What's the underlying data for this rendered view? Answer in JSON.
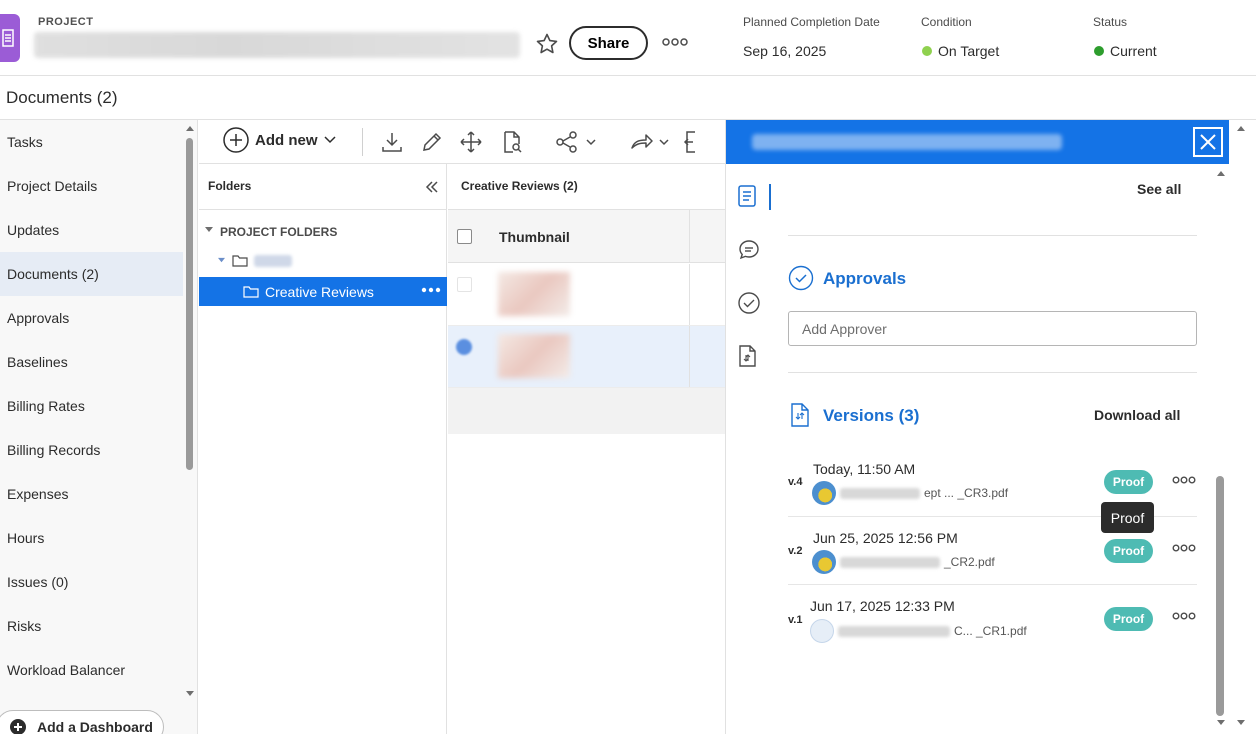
{
  "header": {
    "project_label": "PROJECT",
    "share_label": "Share",
    "meta": [
      {
        "label": "Planned Completion Date",
        "value": "Sep 16, 2025"
      },
      {
        "label": "Condition",
        "value": "On Target",
        "dot_color": "#8fd14f"
      },
      {
        "label": "Status",
        "value": "Current",
        "dot_color": "#2d9d2d"
      }
    ]
  },
  "page_title": "Documents (2)",
  "sidebar": {
    "items": [
      {
        "label": "Tasks"
      },
      {
        "label": "Project Details"
      },
      {
        "label": "Updates"
      },
      {
        "label": "Documents (2)"
      },
      {
        "label": "Approvals"
      },
      {
        "label": "Baselines"
      },
      {
        "label": "Billing Rates"
      },
      {
        "label": "Billing Records"
      },
      {
        "label": "Expenses"
      },
      {
        "label": "Hours"
      },
      {
        "label": "Issues (0)"
      },
      {
        "label": "Risks"
      },
      {
        "label": "Workload Balancer"
      }
    ],
    "add_dashboard": "Add a Dashboard"
  },
  "toolbar": {
    "add_new": "Add new"
  },
  "folders": {
    "title": "Folders",
    "project_folders": "PROJECT FOLDERS",
    "selected_folder": "Creative Reviews"
  },
  "doclist": {
    "title": "Creative Reviews (2)",
    "column_thumbnail": "Thumbnail"
  },
  "panel": {
    "see_all": "See all",
    "approvals_title": "Approvals",
    "add_approver_placeholder": "Add Approver",
    "versions_title": "Versions (3)",
    "download_all": "Download all",
    "versions": [
      {
        "label": "v.4",
        "date": "Today, 11:50 AM",
        "file_suffix": "ept ...  _CR3.pdf",
        "proof": "Proof"
      },
      {
        "label": "v.2",
        "date": "Jun 25, 2025 12:56 PM",
        "file_suffix": "_CR2.pdf",
        "proof": "Proof"
      },
      {
        "label": "v.1",
        "date": "Jun 17, 2025 12:33 PM",
        "file_suffix": "C...  _CR1.pdf",
        "proof": "Proof"
      }
    ],
    "tooltip": "Proof"
  },
  "colors": {
    "accent": "#1473e6",
    "proof": "#4ebbb3",
    "project_icon": "#9b5cd6"
  }
}
